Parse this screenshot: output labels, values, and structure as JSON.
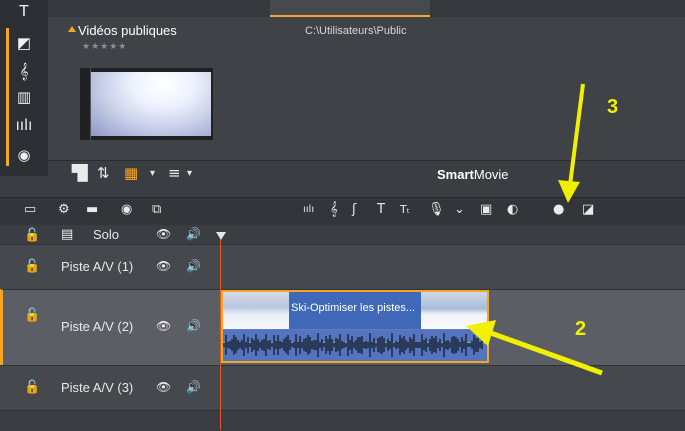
{
  "library": {
    "title": "Vidéos publiques",
    "path": "C:\\Utilisateurs\\Public",
    "rating": "★★★★★",
    "smartmovie_prefix": "Smart",
    "smartmovie_suffix": "Movie"
  },
  "timeline": {
    "tracks": [
      {
        "name": "Solo"
      },
      {
        "name": "Piste A/V (1)"
      },
      {
        "name": "Piste A/V (2)"
      },
      {
        "name": "Piste A/V (3)"
      }
    ],
    "clip": {
      "title": "Ski-Optimiser les pistes..."
    }
  },
  "annotations": {
    "label_3": "3",
    "label_2": "2"
  },
  "colors": {
    "accent": "#f5a623",
    "annotation": "#f0f000",
    "clip": "#5a7fc0",
    "playhead": "#e05a1e"
  }
}
